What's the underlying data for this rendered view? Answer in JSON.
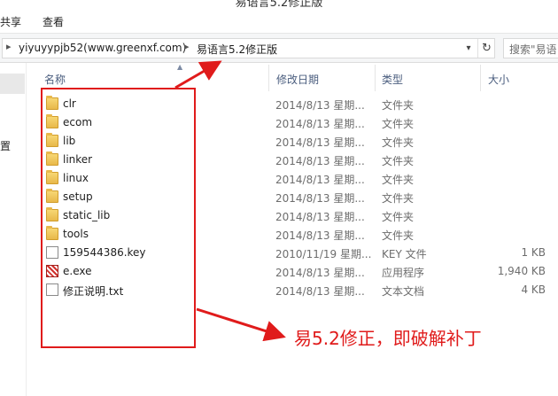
{
  "window": {
    "title": "易语言5.2修正版"
  },
  "menu": {
    "items": [
      "共享",
      "查看"
    ]
  },
  "address": {
    "crumbs": [
      "yiyuyypjb52(www.greenxf.com)",
      "易语言5.2修正版"
    ]
  },
  "search": {
    "placeholder": "搜索\"易语"
  },
  "nav": {
    "partial_label": "置"
  },
  "columns": {
    "name": "名称",
    "date": "修改日期",
    "type": "类型",
    "size": "大小"
  },
  "files": [
    {
      "name": "clr",
      "date": "2014/8/13 星期...",
      "type": "文件夹",
      "size": "",
      "icon": "folder-icon"
    },
    {
      "name": "ecom",
      "date": "2014/8/13 星期...",
      "type": "文件夹",
      "size": "",
      "icon": "folder-icon"
    },
    {
      "name": "lib",
      "date": "2014/8/13 星期...",
      "type": "文件夹",
      "size": "",
      "icon": "folder-icon"
    },
    {
      "name": "linker",
      "date": "2014/8/13 星期...",
      "type": "文件夹",
      "size": "",
      "icon": "folder-icon"
    },
    {
      "name": "linux",
      "date": "2014/8/13 星期...",
      "type": "文件夹",
      "size": "",
      "icon": "folder-icon"
    },
    {
      "name": "setup",
      "date": "2014/8/13 星期...",
      "type": "文件夹",
      "size": "",
      "icon": "folder-icon"
    },
    {
      "name": "static_lib",
      "date": "2014/8/13 星期...",
      "type": "文件夹",
      "size": "",
      "icon": "folder-icon"
    },
    {
      "name": "tools",
      "date": "2014/8/13 星期...",
      "type": "文件夹",
      "size": "",
      "icon": "folder-icon"
    },
    {
      "name": "159544386.key",
      "date": "2010/11/19 星期...",
      "type": "KEY 文件",
      "size": "1 KB",
      "icon": "document-icon"
    },
    {
      "name": "e.exe",
      "date": "2014/8/13 星期...",
      "type": "应用程序",
      "size": "1,940 KB",
      "icon": "exe-icon"
    },
    {
      "name": "修正说明.txt",
      "date": "2014/8/13 星期...",
      "type": "文本文档",
      "size": "4 KB",
      "icon": "document-icon"
    }
  ],
  "annotation": {
    "text": "易5.2修正，即破解补丁",
    "color": "#e01b1b"
  }
}
